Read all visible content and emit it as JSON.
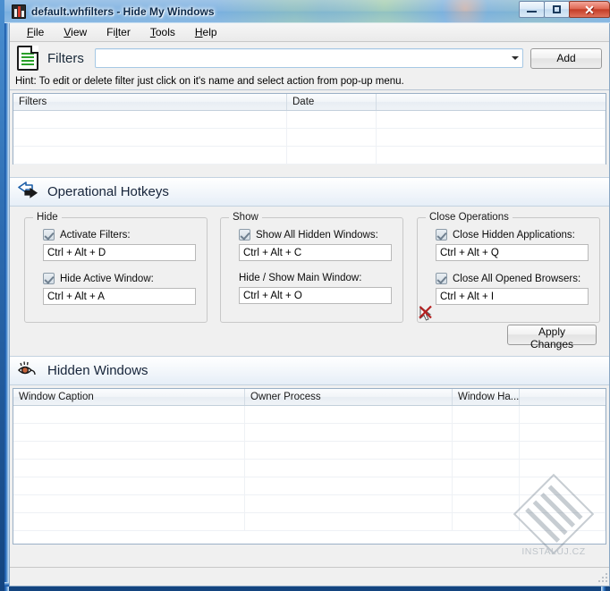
{
  "window": {
    "title": "default.whfilters - Hide My Windows",
    "app_icon": "app-window-icon",
    "caption_buttons": {
      "minimize": "Minimize",
      "maximize": "Maximize",
      "close": "Close"
    }
  },
  "menubar": {
    "items": [
      {
        "label": "File",
        "accel": "F"
      },
      {
        "label": "View",
        "accel": "V"
      },
      {
        "label": "Filter",
        "accel": "l"
      },
      {
        "label": "Tools",
        "accel": "T"
      },
      {
        "label": "Help",
        "accel": "H"
      }
    ]
  },
  "filters_bar": {
    "icon": "filters-clipboard-icon",
    "label": "Filters",
    "combo_value": "",
    "combo_placeholder": "",
    "add_label": "Add"
  },
  "hint": {
    "text": "Hint: To edit or delete filter just click on it's name and select action from pop-up menu."
  },
  "filters_grid": {
    "columns": [
      "Filters",
      "Date",
      ""
    ],
    "rows": []
  },
  "hotkeys_section": {
    "icon": "swap-arrows-icon",
    "title": "Operational Hotkeys",
    "groups": [
      {
        "title": "Hide",
        "fields": [
          {
            "label": "Activate Filters:",
            "checkbox": true,
            "checked": true,
            "value": "Ctrl + Alt + D"
          },
          {
            "label": "Hide Active Window:",
            "checkbox": true,
            "checked": true,
            "value": "Ctrl + Alt + A"
          }
        ]
      },
      {
        "title": "Show",
        "fields": [
          {
            "label": "Show All Hidden Windows:",
            "checkbox": true,
            "checked": true,
            "value": "Ctrl + Alt + C"
          },
          {
            "label": "Hide / Show Main Window:",
            "checkbox": false,
            "checked": false,
            "value": "Ctrl + Alt + O"
          }
        ]
      },
      {
        "title": "Close Operations",
        "fields": [
          {
            "label": "Close Hidden Applications:",
            "checkbox": true,
            "checked": true,
            "value": "Ctrl + Alt + Q"
          },
          {
            "label": "Close All Opened Browsers:",
            "checkbox": true,
            "checked": true,
            "value": "Ctrl + Alt + I"
          }
        ]
      }
    ],
    "apply_label": "Apply Changes",
    "cursor_icon": "no-drop-cursor-icon"
  },
  "hidden_windows_section": {
    "icon": "eye-icon",
    "title": "Hidden Windows",
    "columns": [
      "Window Caption",
      "Owner Process",
      "Window Ha...",
      ""
    ],
    "rows": []
  },
  "watermark": {
    "text": "INSTALUJ.CZ"
  },
  "colors": {
    "frame_blue": "#1b56a4",
    "accent_green": "#2aa02a",
    "close_red": "#c33d26",
    "section_text": "#16243a",
    "cursor_red": "#b41f1f"
  }
}
